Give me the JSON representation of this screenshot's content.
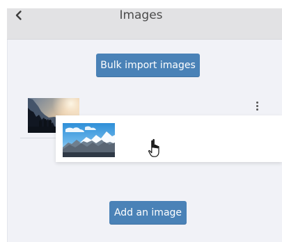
{
  "header": {
    "title": "Images",
    "back_icon": "chevron-left-icon"
  },
  "actions": {
    "bulk_import_label": "Bulk import images",
    "add_image_label": "Add an image"
  },
  "images": [
    {
      "thumbnail_icon": "sunset-cliff-image"
    },
    {
      "thumbnail_icon": "snowy-mountain-image"
    }
  ],
  "icons": {
    "more": "vertical-ellipsis-icon",
    "cursor": "hand-cursor-icon"
  },
  "colors": {
    "accent": "#4a82b7",
    "header_bg": "#e2e2e4",
    "panel_bg": "#f1f2f7",
    "text": "#4b4b4b"
  }
}
